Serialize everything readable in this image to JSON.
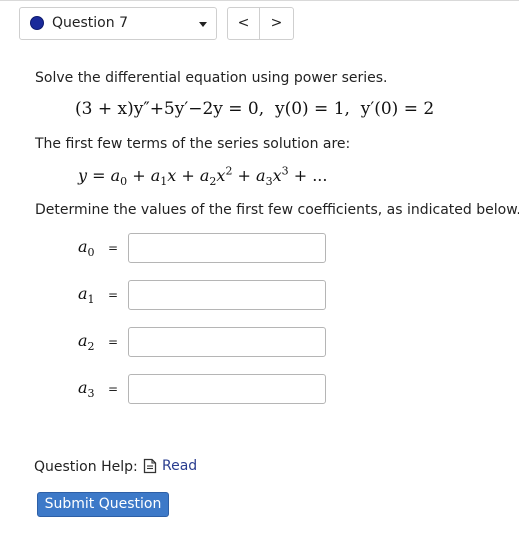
{
  "header": {
    "question_label": "Question 7",
    "prev_symbol": "<",
    "next_symbol": ">"
  },
  "prompt": {
    "instruction": "Solve the differential equation using power series.",
    "equation_lhs_factor": "(3 + x)y″",
    "equation_rest": "+5y′−2y = 0,",
    "initial_condition_1": "y(0) = 1,",
    "initial_condition_2": "y′(0) = 2",
    "series_intro": "The first few terms of the series solution are:",
    "series_prefix": "y = a",
    "series_sub0": "0",
    "series_mid1": " + a",
    "series_sub1": "1",
    "series_mid2": "x + a",
    "series_sub2": "2",
    "series_mid3": "x",
    "series_pow2": "2",
    "series_mid4": " + a",
    "series_sub3": "3",
    "series_mid5": "x",
    "series_pow3": "3",
    "series_tail": " + ...",
    "coef_instruction": "Determine the values of the first few coefficients, as indicated below."
  },
  "answers": [
    {
      "label": "a",
      "sub": "0",
      "eq": "=",
      "value": ""
    },
    {
      "label": "a",
      "sub": "1",
      "eq": "=",
      "value": ""
    },
    {
      "label": "a",
      "sub": "2",
      "eq": "=",
      "value": ""
    },
    {
      "label": "a",
      "sub": "3",
      "eq": "=",
      "value": ""
    }
  ],
  "help": {
    "label": "Question Help:",
    "read_label": "Read",
    "read_icon": "document-icon"
  },
  "submit_label": "Submit Question",
  "colors": {
    "question_dot": "#1a2a9a",
    "link": "#2a3d8f",
    "submit_bg": "#3d79c8"
  }
}
